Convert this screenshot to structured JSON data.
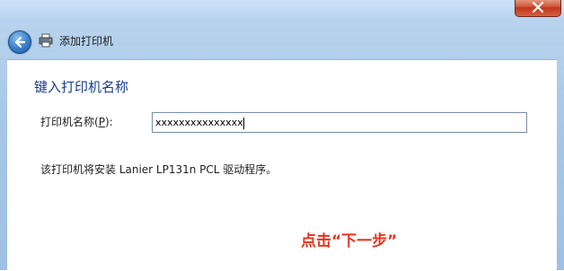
{
  "window": {
    "title": "添加打印机",
    "close_icon": "close-icon",
    "back_icon": "back-arrow-icon",
    "printer_icon": "printer-icon"
  },
  "page": {
    "heading": "键入打印机名称",
    "field_label": "打印机名称(",
    "field_hotkey": "P",
    "field_label_end": "):",
    "field_value": "xxxxxxxxxxxxxxx",
    "info": "该打印机将安装 Lanier LP131n PCL 驱动程序。"
  },
  "annotation": {
    "text": "点击“下一步”",
    "color": "#e8331e"
  }
}
